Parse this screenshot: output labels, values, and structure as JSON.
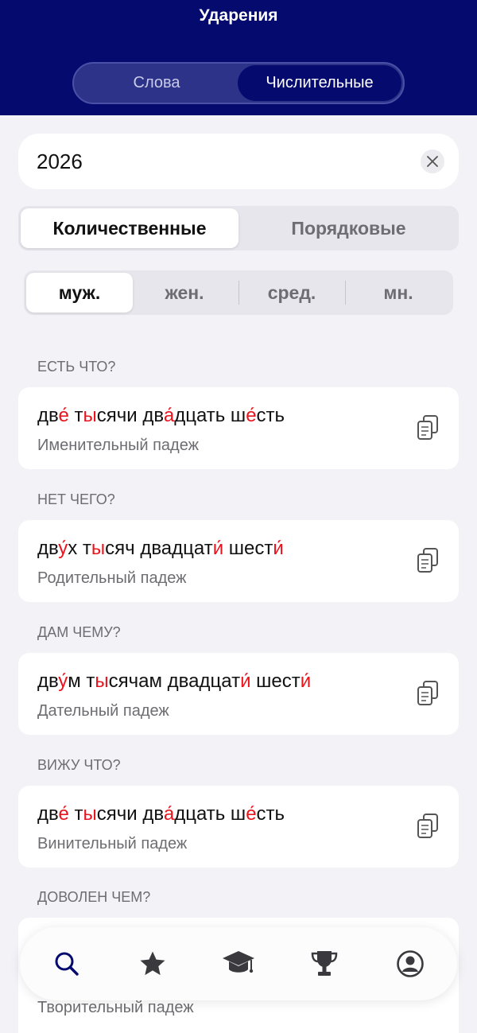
{
  "header": {
    "title": "Ударения",
    "tabs": [
      {
        "label": "Слова",
        "active": false
      },
      {
        "label": "Числительные",
        "active": true
      }
    ]
  },
  "search": {
    "value": "2026",
    "clear_icon": "close-icon"
  },
  "number_type": [
    {
      "label": "Количественные",
      "active": true
    },
    {
      "label": "Порядковые",
      "active": false
    }
  ],
  "gender": [
    {
      "label": "муж.",
      "active": true
    },
    {
      "label": "жен.",
      "active": false
    },
    {
      "label": "сред.",
      "active": false
    },
    {
      "label": "мн.",
      "active": false
    }
  ],
  "accent_color": "#e8141e",
  "cases": [
    {
      "question": "ЕСТЬ ЧТО?",
      "case": "Именительный падеж",
      "parts": [
        {
          "t": "дв"
        },
        {
          "t": "е́",
          "a": true
        },
        {
          "t": " т"
        },
        {
          "t": "ы",
          "a": true
        },
        {
          "t": "сячи дв"
        },
        {
          "t": "а́",
          "a": true
        },
        {
          "t": "дцать ш"
        },
        {
          "t": "е́",
          "a": true
        },
        {
          "t": "сть"
        }
      ]
    },
    {
      "question": "НЕТ ЧЕГО?",
      "case": "Родительный падеж",
      "parts": [
        {
          "t": "дв"
        },
        {
          "t": "у́",
          "a": true
        },
        {
          "t": "х т"
        },
        {
          "t": "ы",
          "a": true
        },
        {
          "t": "сяч двадцат"
        },
        {
          "t": "и́",
          "a": true
        },
        {
          "t": " шест"
        },
        {
          "t": "и́",
          "a": true
        }
      ]
    },
    {
      "question": "ДАМ ЧЕМУ?",
      "case": "Дательный падеж",
      "parts": [
        {
          "t": "дв"
        },
        {
          "t": "у́",
          "a": true
        },
        {
          "t": "м т"
        },
        {
          "t": "ы",
          "a": true
        },
        {
          "t": "сячам двадцат"
        },
        {
          "t": "и́",
          "a": true
        },
        {
          "t": " шест"
        },
        {
          "t": "и́",
          "a": true
        }
      ]
    },
    {
      "question": "ВИЖУ ЧТО?",
      "case": "Винительный падеж",
      "parts": [
        {
          "t": "дв"
        },
        {
          "t": "е́",
          "a": true
        },
        {
          "t": " т"
        },
        {
          "t": "ы",
          "a": true
        },
        {
          "t": "сячи дв"
        },
        {
          "t": "а́",
          "a": true
        },
        {
          "t": "дцать ш"
        },
        {
          "t": "е́",
          "a": true
        },
        {
          "t": "сть"
        }
      ]
    },
    {
      "question": "ДОВОЛЕН ЧЕМ?",
      "case": "Творительный падеж",
      "parts": []
    }
  ],
  "tabbar": [
    {
      "icon": "search-icon",
      "active": true
    },
    {
      "icon": "star-icon",
      "active": false
    },
    {
      "icon": "graduation-cap-icon",
      "active": false
    },
    {
      "icon": "trophy-icon",
      "active": false
    },
    {
      "icon": "profile-icon",
      "active": false
    }
  ]
}
